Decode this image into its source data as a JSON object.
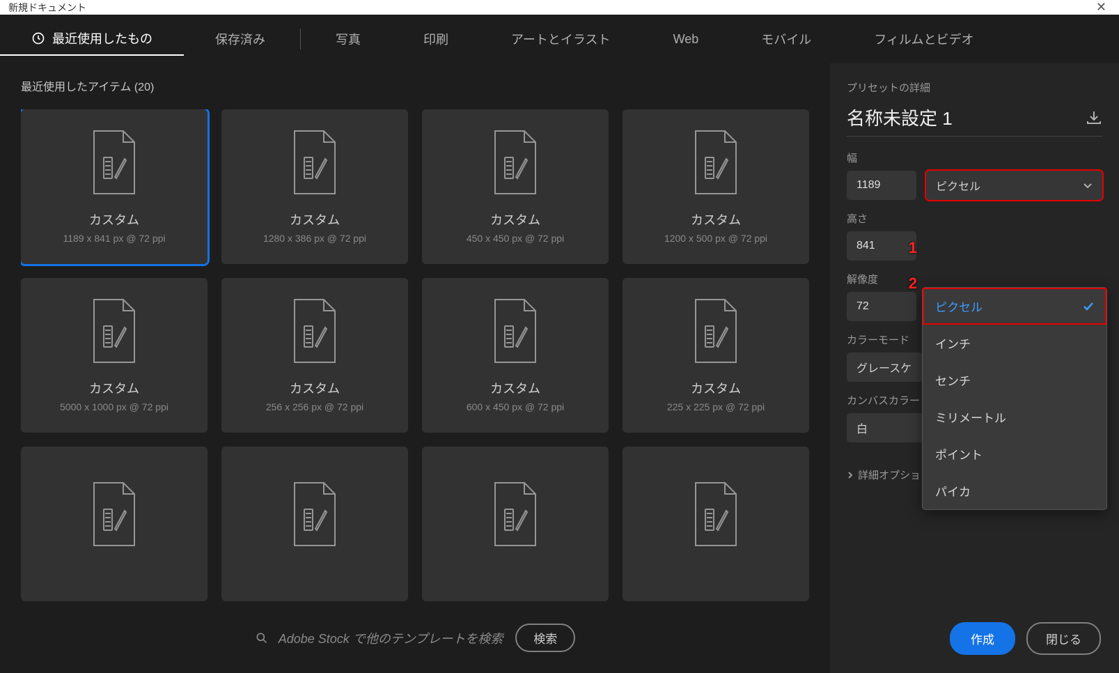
{
  "window_title": "新規ドキュメント",
  "tabs": {
    "recent": "最近使用したもの",
    "saved": "保存済み",
    "photo": "写真",
    "print": "印刷",
    "art": "アートとイラスト",
    "web": "Web",
    "mobile": "モバイル",
    "film": "フィルムとビデオ"
  },
  "section_title": "最近使用したアイテム  (20)",
  "cards": [
    {
      "title": "カスタム",
      "subtitle": "1189 x 841 px @ 72 ppi"
    },
    {
      "title": "カスタム",
      "subtitle": "1280 x 386 px @ 72 ppi"
    },
    {
      "title": "カスタム",
      "subtitle": "450 x 450 px @ 72 ppi"
    },
    {
      "title": "カスタム",
      "subtitle": "1200 x 500 px @ 72 ppi"
    },
    {
      "title": "カスタム",
      "subtitle": "5000 x 1000 px @ 72 ppi"
    },
    {
      "title": "カスタム",
      "subtitle": "256 x 256 px @ 72 ppi"
    },
    {
      "title": "カスタム",
      "subtitle": "600 x 450 px @ 72 ppi"
    },
    {
      "title": "カスタム",
      "subtitle": "225 x 225 px @ 72 ppi"
    },
    {
      "title": "",
      "subtitle": ""
    },
    {
      "title": "",
      "subtitle": ""
    },
    {
      "title": "",
      "subtitle": ""
    },
    {
      "title": "",
      "subtitle": ""
    }
  ],
  "search": {
    "placeholder": "Adobe Stock で他のテンプレートを検索",
    "button": "検索"
  },
  "details": {
    "preset_detail_label": "プリセットの詳細",
    "preset_name": "名称未設定 1",
    "width_label": "幅",
    "width_value": "1189",
    "unit_selected": "ピクセル",
    "height_label": "高さ",
    "height_value": "841",
    "resolution_label": "解像度",
    "resolution_value": "72",
    "color_mode_label": "カラーモード",
    "color_mode_value": "グレースケ",
    "canvas_color_label": "カンバスカラー",
    "canvas_color_value": "白",
    "advanced_label": "詳細オプション"
  },
  "unit_options": [
    "ピクセル",
    "インチ",
    "センチ",
    "ミリメートル",
    "ポイント",
    "パイカ"
  ],
  "annotations": {
    "one": "1",
    "two": "2"
  },
  "buttons": {
    "create": "作成",
    "close": "閉じる"
  }
}
